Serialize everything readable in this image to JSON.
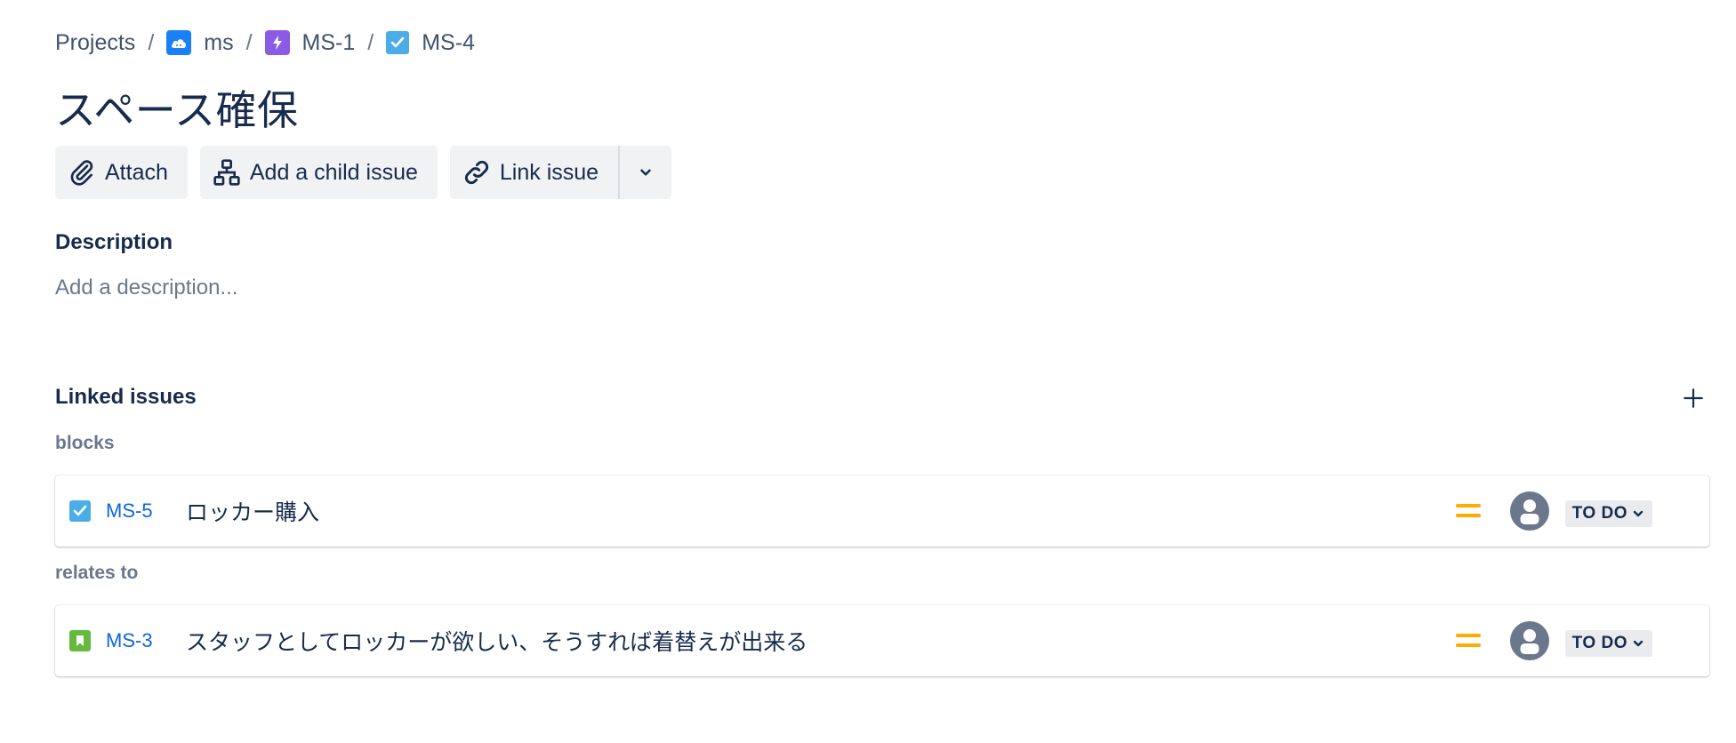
{
  "breadcrumb": {
    "items": [
      {
        "label": "Projects",
        "icon": null
      },
      {
        "label": "ms",
        "icon": "project-cloud-icon"
      },
      {
        "label": "MS-1",
        "icon": "epic-lightning-icon"
      },
      {
        "label": "MS-4",
        "icon": "task-check-icon"
      }
    ],
    "separator": "/"
  },
  "issue": {
    "title": "スペース確保"
  },
  "toolbar": {
    "attach_label": "Attach",
    "add_child_label": "Add a child issue",
    "link_issue_label": "Link issue"
  },
  "description": {
    "heading": "Description",
    "placeholder": "Add a description..."
  },
  "linked_issues": {
    "heading": "Linked issues",
    "groups": [
      {
        "label": "blocks",
        "issues": [
          {
            "type": "task",
            "key": "MS-5",
            "summary": "ロッカー購入",
            "priority": "medium",
            "status": "TO DO"
          }
        ]
      },
      {
        "label": "relates to",
        "issues": [
          {
            "type": "story",
            "key": "MS-3",
            "summary": "スタッフとしてロッカーが欲しい、そうすれば着替えが出来る",
            "priority": "medium",
            "status": "TO DO"
          }
        ]
      }
    ]
  },
  "colors": {
    "link_blue": "#0c66e4",
    "task_blue": "#4bade8",
    "epic_purple": "#8c5be6",
    "story_green": "#63ba3c",
    "priority_medium": "#ffab00",
    "text_primary": "#172b4d",
    "text_subtle": "#6b778c"
  }
}
